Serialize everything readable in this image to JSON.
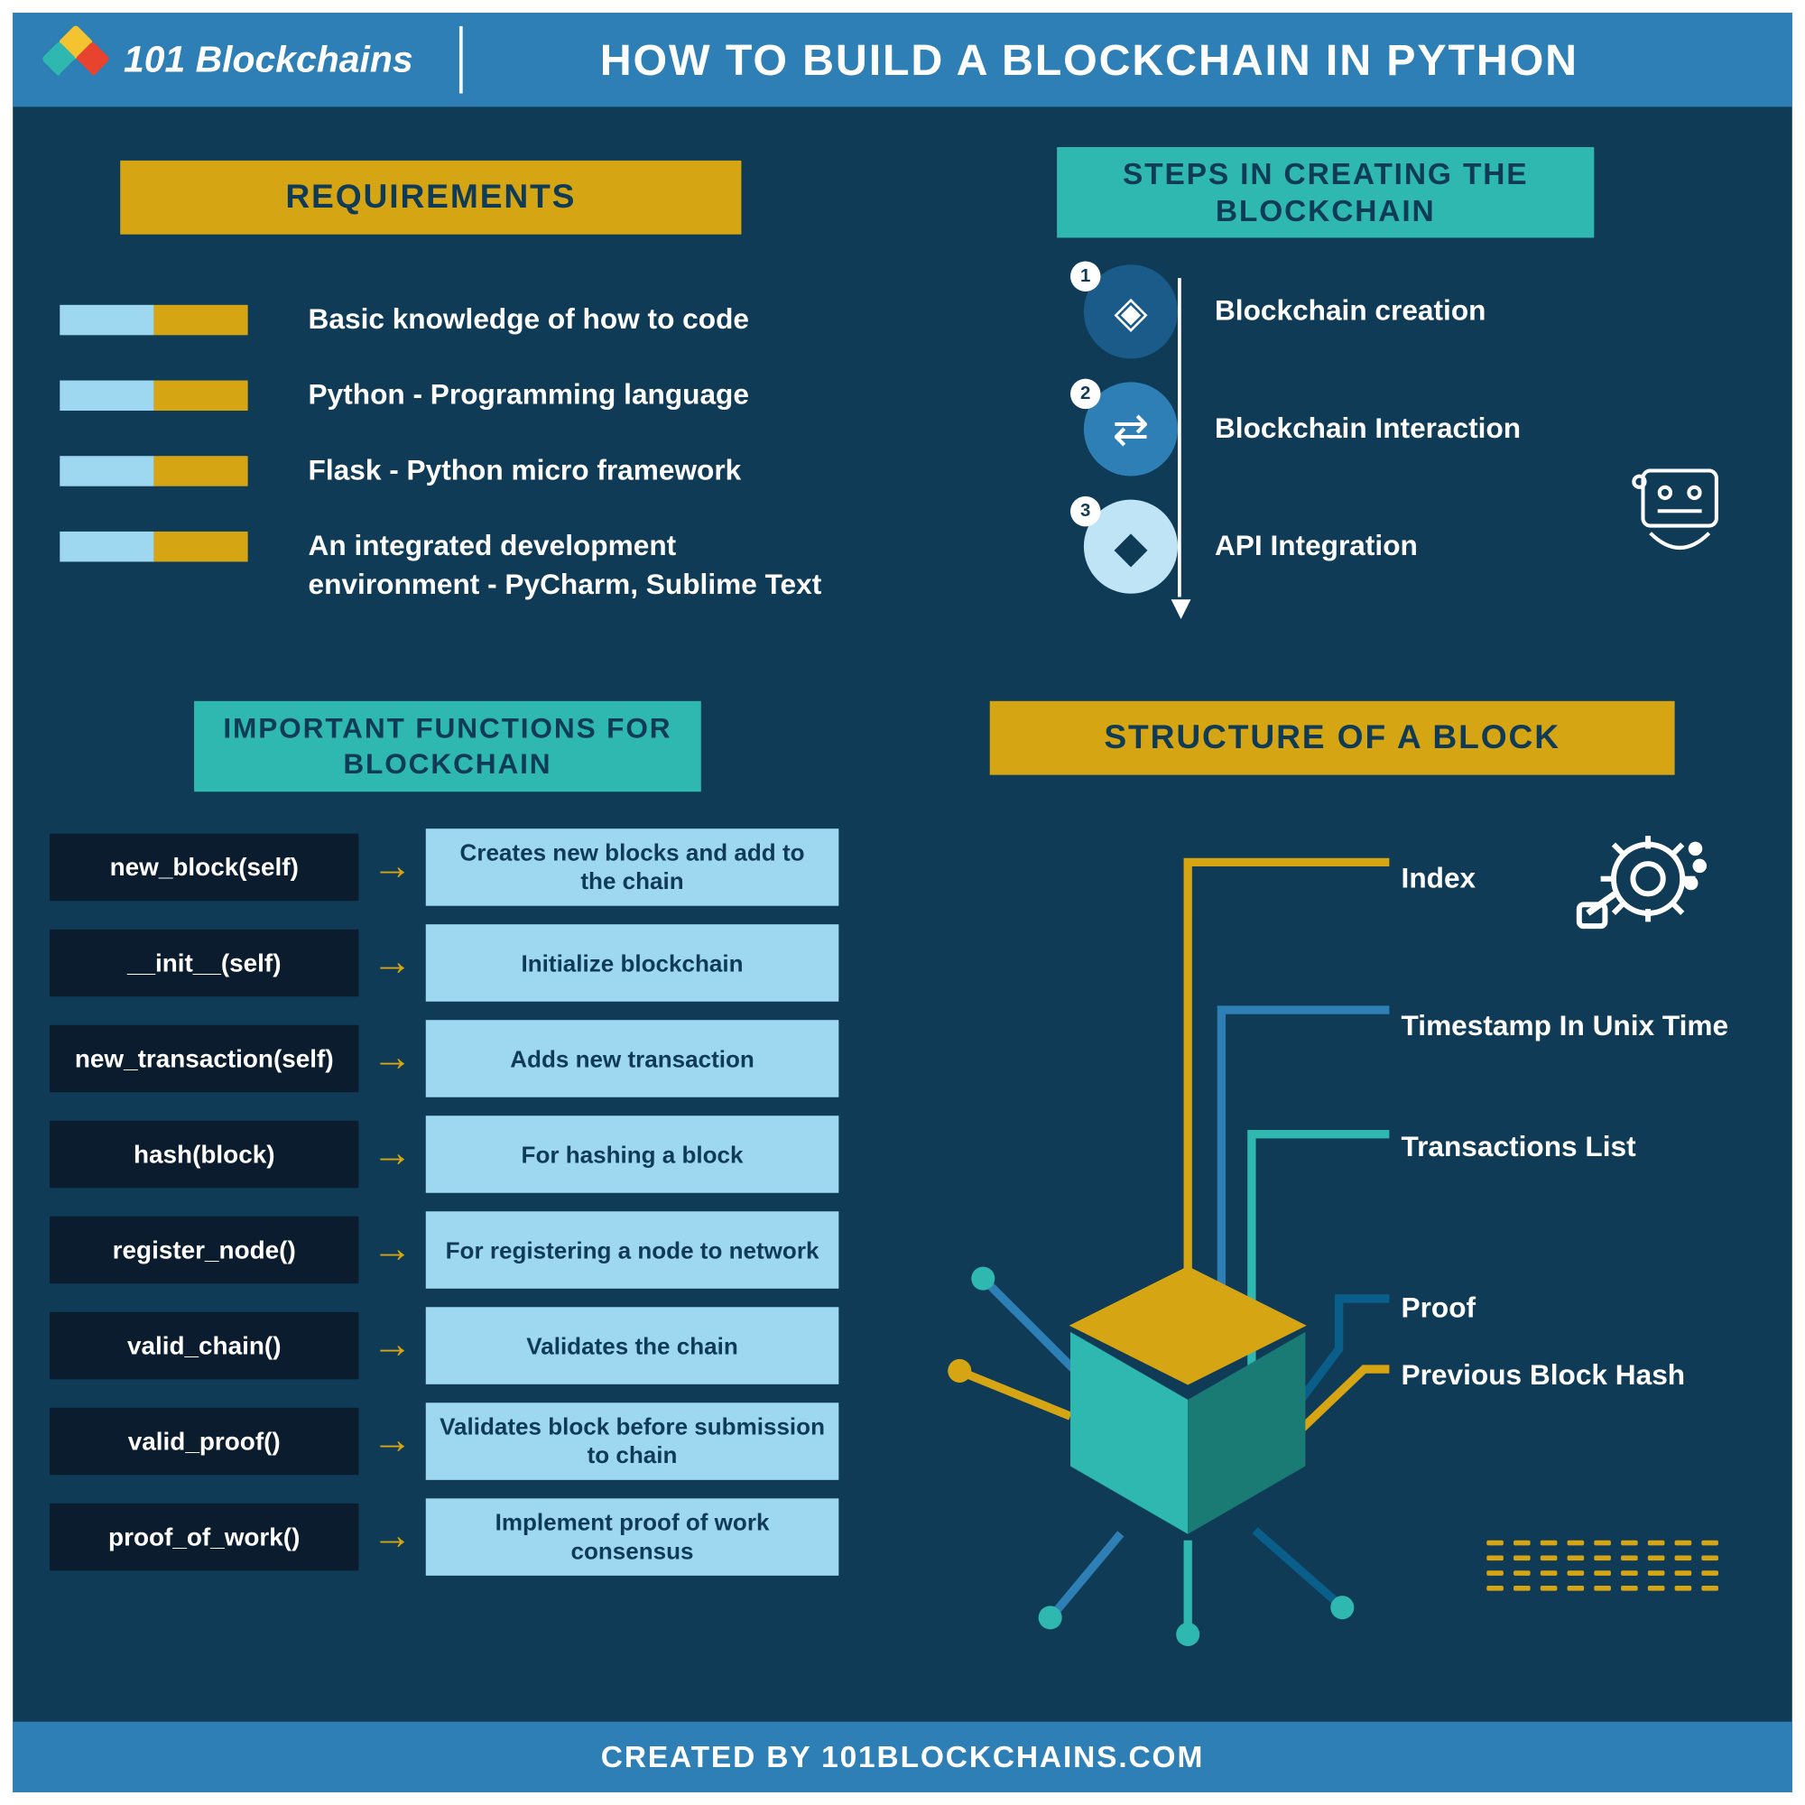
{
  "header": {
    "logo_text": "101 Blockchains",
    "title": "HOW TO BUILD A BLOCKCHAIN IN PYTHON"
  },
  "requirements": {
    "title": "REQUIREMENTS",
    "items": [
      "Basic knowledge of how to code",
      "Python - Programming language",
      "Flask - Python micro framework",
      "An integrated development environment - PyCharm, Sublime Text"
    ]
  },
  "functions": {
    "title": "IMPORTANT FUNCTIONS FOR BLOCKCHAIN",
    "items": [
      {
        "name": "new_block(self)",
        "desc": "Creates new blocks and add to the chain"
      },
      {
        "name": "__init__(self)",
        "desc": "Initialize blockchain"
      },
      {
        "name": "new_transaction(self)",
        "desc": "Adds new transaction"
      },
      {
        "name": "hash(block)",
        "desc": "For hashing a block"
      },
      {
        "name": "register_node()",
        "desc": "For registering a node to network"
      },
      {
        "name": "valid_chain()",
        "desc": "Validates the chain"
      },
      {
        "name": "valid_proof()",
        "desc": "Validates block before submission to chain"
      },
      {
        "name": "proof_of_work()",
        "desc": "Implement proof of work consensus"
      }
    ]
  },
  "steps": {
    "title": "STEPS IN CREATING THE BLOCKCHAIN",
    "items": [
      {
        "num": "1",
        "label": "Blockchain creation"
      },
      {
        "num": "2",
        "label": "Blockchain Interaction"
      },
      {
        "num": "3",
        "label": "API Integration"
      }
    ]
  },
  "structure": {
    "title": "STRUCTURE OF A BLOCK",
    "items": [
      "Index",
      "Timestamp In Unix Time",
      "Transactions List",
      "Proof",
      "Previous Block Hash"
    ]
  },
  "footer": "CREATED BY 101BLOCKCHAINS.COM",
  "icons": {
    "cube": "⬢",
    "link": "⛓",
    "api": "⚙",
    "robot": "🤖",
    "gear": "⚙"
  }
}
